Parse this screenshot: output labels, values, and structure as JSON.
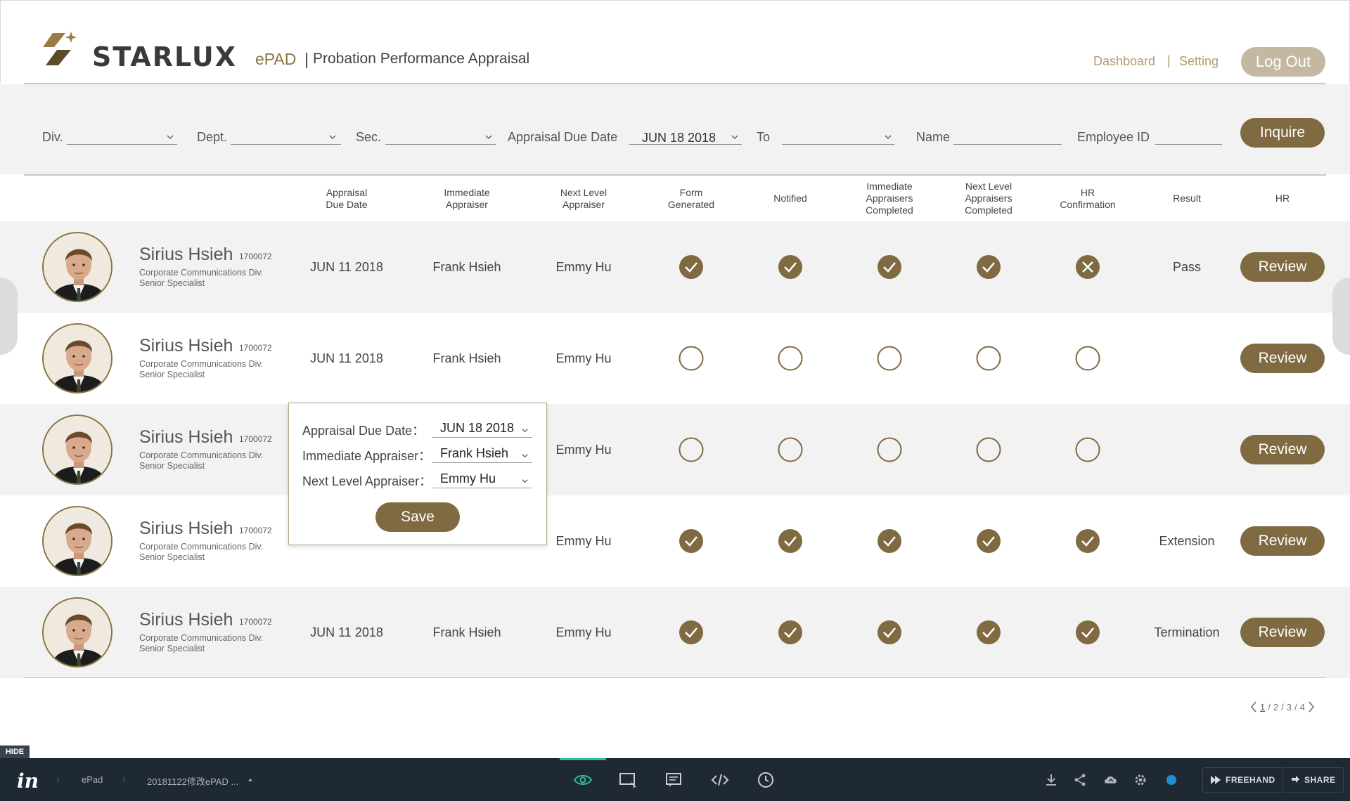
{
  "header": {
    "logo_text": "STARLUX",
    "app_name": "ePAD",
    "separator": "|",
    "subtitle": "Probation Performance Appraisal",
    "nav": {
      "dashboard": "Dashboard",
      "separator": "|",
      "setting": "Setting"
    },
    "logout_label": "Log Out"
  },
  "filters": {
    "div_label": "Div.",
    "dept_label": "Dept.",
    "sec_label": "Sec.",
    "due_date_label": "Appraisal Due Date",
    "due_date_value": "JUN 18 2018",
    "to_label": "To",
    "name_label": "Name",
    "employee_id_label": "Employee ID",
    "inquire_label": "Inquire"
  },
  "table": {
    "headers": [
      "Appraisal\nDue Date",
      "Immediate\nAppraiser",
      "Next Level\nAppraiser",
      "Form\nGenerated",
      "Notified",
      "Immediate\nAppraisers\nCompleted",
      "Next Level\nAppraisers\nCompleted",
      "HR\nConfirmation",
      "Result",
      "HR"
    ],
    "review_label": "Review",
    "rows": [
      {
        "name": "Sirius Hsieh",
        "id": "1700072",
        "division": "Corporate Communications Div.",
        "title": "Senior Specialist",
        "due_date": "JUN 11 2018",
        "immediate": "Frank Hsieh",
        "next_level": "Emmy Hu",
        "statuses": [
          "checked",
          "checked",
          "checked",
          "checked",
          "rejected"
        ],
        "result": "Pass"
      },
      {
        "name": "Sirius Hsieh",
        "id": "1700072",
        "division": "Corporate Communications Div.",
        "title": "Senior Specialist",
        "due_date": "JUN 11 2018",
        "immediate": "Frank Hsieh",
        "next_level": "Emmy Hu",
        "statuses": [
          "empty",
          "empty",
          "empty",
          "empty",
          "empty"
        ],
        "result": ""
      },
      {
        "name": "Sirius Hsieh",
        "id": "1700072",
        "division": "Corporate Communications Div.",
        "title": "Senior Specialist",
        "due_date": "",
        "immediate": "",
        "next_level": "Emmy Hu",
        "statuses": [
          "empty",
          "empty",
          "empty",
          "empty",
          "empty"
        ],
        "result": ""
      },
      {
        "name": "Sirius Hsieh",
        "id": "1700072",
        "division": "Corporate Communications Div.",
        "title": "Senior Specialist",
        "due_date": "",
        "immediate": "",
        "next_level": "Emmy Hu",
        "statuses": [
          "checked",
          "checked",
          "checked",
          "checked",
          "checked"
        ],
        "result": "Extension"
      },
      {
        "name": "Sirius Hsieh",
        "id": "1700072",
        "division": "Corporate Communications Div.",
        "title": "Senior Specialist",
        "due_date": "JUN 11 2018",
        "immediate": "Frank Hsieh",
        "next_level": "Emmy Hu",
        "statuses": [
          "checked",
          "checked",
          "checked",
          "checked",
          "checked"
        ],
        "result": "Termination"
      }
    ]
  },
  "pagination": {
    "pages": [
      "1",
      "2",
      "3",
      "4"
    ],
    "current": "1",
    "separator": "/"
  },
  "popup": {
    "due_date_label": "Appraisal Due Date：",
    "due_date_value": "JUN 18 2018",
    "immediate_label": "Immediate Appraiser：",
    "immediate_value": "Frank Hsieh",
    "next_level_label": "Next Level Appraiser：",
    "next_level_value": "Emmy Hu",
    "save_label": "Save"
  },
  "toolbar": {
    "hide_label": "HIDE",
    "logo": "in",
    "breadcrumb": [
      "ePad",
      "20181122修改ePAD ..."
    ],
    "freehand_label": "FREEHAND",
    "share_label": "SHARE"
  },
  "colors": {
    "brand": "#7f6a41",
    "brand_light": "#b49a6c",
    "logout": "#c5b8a2",
    "row_alt": "#f2f2f2",
    "toolbar": "#1f2933"
  }
}
